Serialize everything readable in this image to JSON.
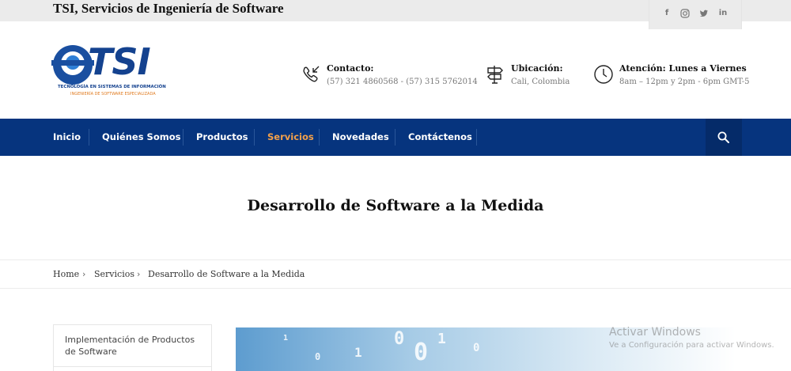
{
  "topbar": {
    "site_title": "TSI, Servicios de Ingeniería de Software",
    "social": [
      "facebook-icon",
      "instagram-icon",
      "twitter-icon",
      "linkedin-icon"
    ]
  },
  "logo": {
    "brand": "TSI",
    "tagline": "TECNOLOGÍA EN SISTEMAS DE INFORMACIÓN",
    "subtagline": "INGENIERÍA DE SOFTWARE ESPECIALIZADA"
  },
  "header": {
    "contact": {
      "label": "Contacto:",
      "value": "(57) 321 4860568 - (57) 315 5762014"
    },
    "location": {
      "label": "Ubicación:",
      "value": "Cali, Colombia"
    },
    "hours": {
      "label": "Atención: Lunes a Viernes",
      "value": "8am – 12pm y 2pm - 6pm GMT-5"
    }
  },
  "nav": {
    "items": [
      {
        "label": "Inicio"
      },
      {
        "label": "Quiénes Somos"
      },
      {
        "label": "Productos"
      },
      {
        "label": "Servicios",
        "active": true
      },
      {
        "label": "Novedades"
      },
      {
        "label": "Contáctenos"
      }
    ]
  },
  "page": {
    "title": "Desarrollo de Software a la Medida"
  },
  "breadcrumb": {
    "items": [
      "Home",
      "Servicios",
      "Desarrollo de Software a la Medida"
    ]
  },
  "sidebar": {
    "items": [
      {
        "label": "Implementación de Productos de Software"
      }
    ]
  },
  "watermark": {
    "title": "Activar Windows",
    "subtitle": "Ve a Configuración para activar Windows."
  },
  "colors": {
    "nav_bg": "#06347e",
    "nav_active": "#f2a04a",
    "brand_blue": "#14428f",
    "brand_orange": "#e07b20"
  }
}
